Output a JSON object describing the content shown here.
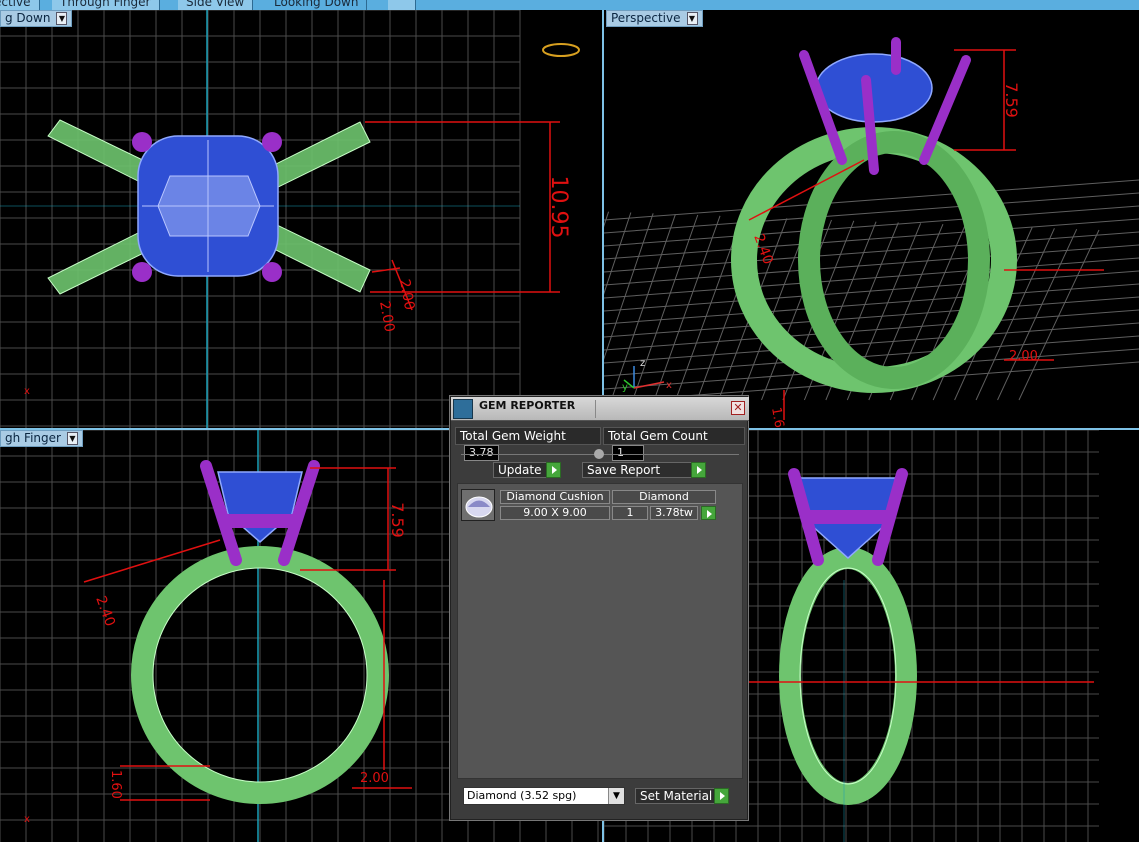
{
  "tabs": [
    {
      "label": "ective"
    },
    {
      "label": "Through Finger"
    },
    {
      "label": "Side View"
    },
    {
      "label": "Looking Down"
    },
    {
      "label": ""
    }
  ],
  "viewports": {
    "top_left": {
      "label": "g Down",
      "dims": {
        "height": "10.95",
        "prong_a": "2.00",
        "prong_b": "2.00"
      },
      "axis_x": "x"
    },
    "top_right": {
      "label": "Perspective",
      "dims": {
        "height": "7.59",
        "width": "2.40",
        "shank": "2.00",
        "base": "1.60"
      },
      "axis_x": "x",
      "axis_y": "y",
      "axis_z": "z"
    },
    "bottom_left": {
      "label": "gh Finger",
      "dims": {
        "height": "7.59",
        "width": "2.40",
        "shank": "2.00",
        "base": "1.60"
      },
      "axis_x": "x"
    },
    "bottom_right": {
      "label": ""
    }
  },
  "gem_reporter": {
    "title": "GEM REPORTER",
    "total_weight_label": "Total Gem Weight",
    "total_weight_value": "3.78",
    "total_count_label": "Total Gem Count",
    "total_count_value": "1",
    "update_label": "Update",
    "save_report_label": "Save Report",
    "gem": {
      "name": "Diamond Cushion",
      "size": "9.00 X 9.00",
      "material": "Diamond",
      "count": "1",
      "weight": "3.78tw"
    },
    "material_select": "Diamond     (3.52 spg)",
    "set_material_label": "Set Material"
  },
  "colors": {
    "shank": "#7ddc7d",
    "gem": "#2d4fd0",
    "prong": "#9a2fc8",
    "dim": "#e01010",
    "grid": "#5a5a5a",
    "accent": "#5aaedf"
  }
}
